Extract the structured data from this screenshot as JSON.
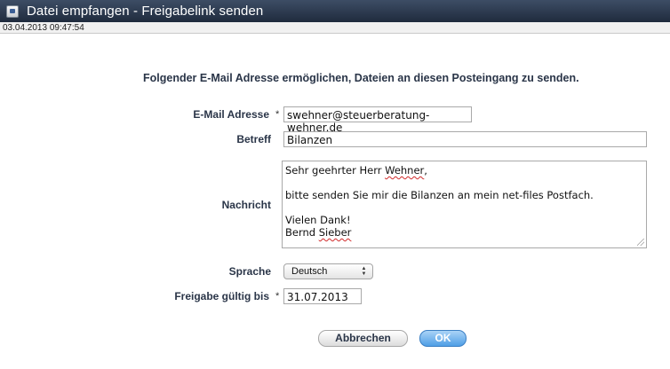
{
  "window": {
    "title": "Datei empfangen - Freigabelink senden",
    "timestamp": "03.04.2013 09:47:54"
  },
  "form": {
    "intro": "Folgender E-Mail Adresse ermöglichen, Dateien an diesen Posteingang zu senden.",
    "required_marker": "*",
    "email": {
      "label": "E-Mail Adresse",
      "value": "swehner@steuerberatung-wehner.de"
    },
    "subject": {
      "label": "Betreff",
      "value": "Bilanzen"
    },
    "message": {
      "label": "Nachricht",
      "lines": [
        "Sehr geehrter Herr Wehner,",
        "",
        "bitte senden Sie mir die Bilanzen an mein net-files Postfach.",
        "",
        "Vielen Dank!",
        "Bernd Sieber"
      ]
    },
    "language": {
      "label": "Sprache",
      "value": "Deutsch"
    },
    "valid_until": {
      "label": "Freigabe gültig bis",
      "value": "31.07.2013"
    }
  },
  "buttons": {
    "cancel": "Abbrechen",
    "ok": "OK"
  },
  "colors": {
    "titlebar": "#2c3a50",
    "ok_button": "#4f9ee6"
  }
}
